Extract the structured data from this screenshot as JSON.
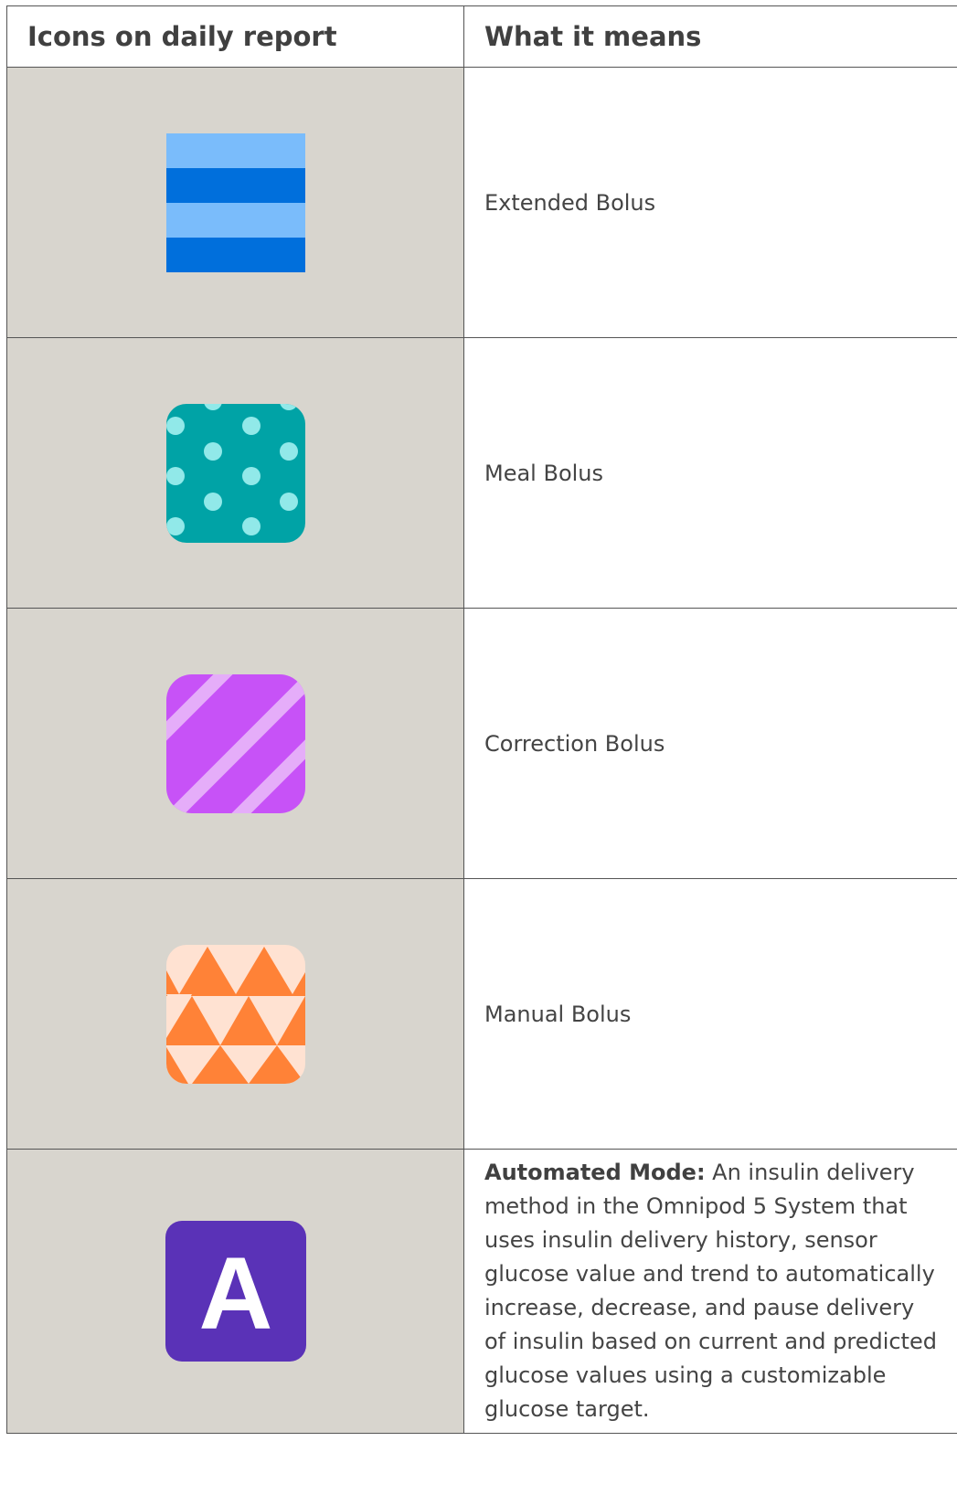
{
  "table": {
    "headers": {
      "icon_column": "Icons on daily report",
      "meaning_column": "What it means"
    },
    "rows": [
      {
        "icon": "extended-bolus-icon",
        "meaning": "Extended Bolus"
      },
      {
        "icon": "meal-bolus-icon",
        "meaning": "Meal Bolus"
      },
      {
        "icon": "correction-bolus-icon",
        "meaning": "Correction Bolus"
      },
      {
        "icon": "manual-bolus-icon",
        "meaning": "Manual Bolus"
      },
      {
        "icon": "automated-mode-icon",
        "icon_letter": "A",
        "term": "Automated Mode:",
        "meaning": " An insulin delivery method in the Omnipod 5 System that uses insulin delivery history, sensor glucose value and trend to automatically increase, decrease, and pause delivery of insulin based on current and predicted glucose values using a customizable glucose target."
      }
    ]
  },
  "colors": {
    "icon_cell_bg": "#d8d5ce",
    "extended_light": "#7abcfb",
    "extended_dark": "#006fdc",
    "meal_bg": "#00a3a6",
    "meal_dot": "#91e9e9",
    "correction_bg": "#c752f7",
    "correction_stripe": "#e5adf9",
    "manual_bg": "#ff8237",
    "manual_light": "#ffe2d2",
    "automated_bg": "#5a32b7",
    "automated_letter": "#ffffff"
  }
}
